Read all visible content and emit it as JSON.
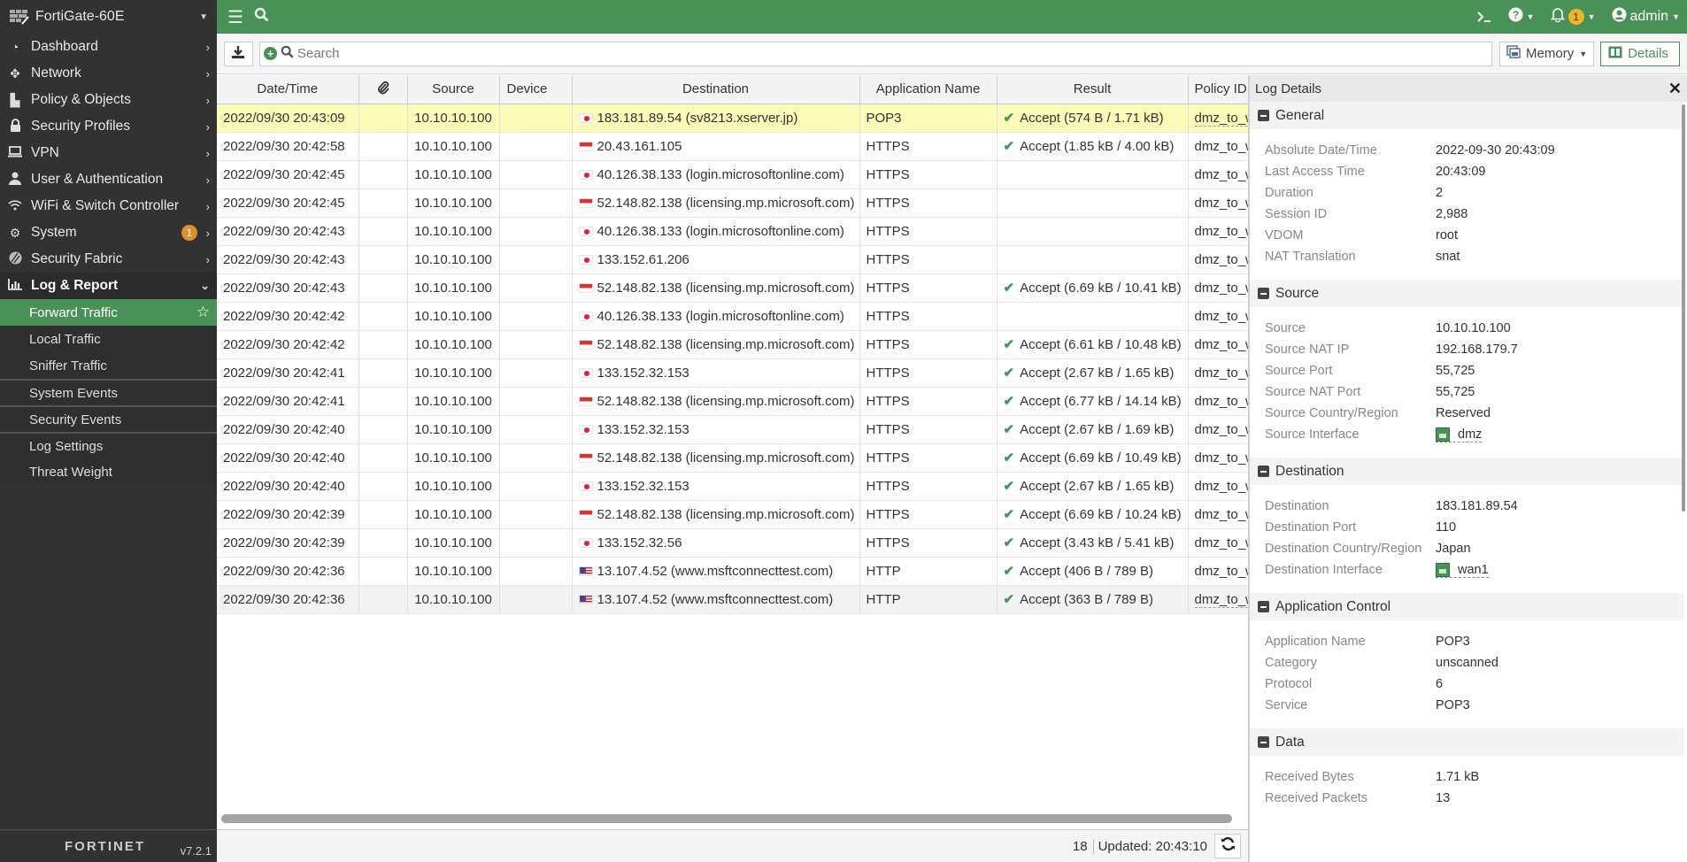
{
  "sidebar": {
    "device_name": "FortiGate-60E",
    "items": [
      {
        "label": "Dashboard",
        "icon": "dashboard-icon"
      },
      {
        "label": "Network",
        "icon": "network-icon"
      },
      {
        "label": "Policy & Objects",
        "icon": "policy-icon"
      },
      {
        "label": "Security Profiles",
        "icon": "lock-icon"
      },
      {
        "label": "VPN",
        "icon": "laptop-icon"
      },
      {
        "label": "User & Authentication",
        "icon": "user-icon"
      },
      {
        "label": "WiFi & Switch Controller",
        "icon": "wifi-icon"
      },
      {
        "label": "System",
        "icon": "gear-icon",
        "badge": "1"
      },
      {
        "label": "Security Fabric",
        "icon": "fabric-icon"
      },
      {
        "label": "Log & Report",
        "icon": "bar-chart-icon"
      }
    ],
    "log_report_sub": [
      {
        "label": "Forward Traffic",
        "active": true
      },
      {
        "label": "Local Traffic"
      },
      {
        "label": "Sniffer Traffic"
      },
      {
        "label": "System Events"
      },
      {
        "label": "Security Events"
      },
      {
        "label": "Log Settings"
      },
      {
        "label": "Threat Weight"
      }
    ],
    "footer_brand": "FORTINET",
    "version": "v7.2.1"
  },
  "topbar": {
    "notification_count": "1",
    "user": "admin"
  },
  "toolbar": {
    "search_placeholder": "Search",
    "memory_label": "Memory",
    "details_label": "Details"
  },
  "table": {
    "columns": [
      "Date/Time",
      "",
      "Source",
      "Device",
      "Destination",
      "Application Name",
      "Result",
      "Policy ID"
    ],
    "rows": [
      {
        "datetime": "2022/09/30 20:43:09",
        "source": "10.10.10.100",
        "device": "",
        "flag": "jp",
        "destination": "183.181.89.54 (sv8213.xserver.jp)",
        "app": "POP3",
        "result": "Accept (574 B / 1.71 kB)",
        "policy": "dmz_to_wan",
        "selected": true
      },
      {
        "datetime": "2022/09/30 20:42:58",
        "source": "10.10.10.100",
        "device": "",
        "flag": "sg",
        "destination": "20.43.161.105",
        "app": "HTTPS",
        "result": "Accept (1.85 kB / 4.00 kB)",
        "policy": "dmz_to_wan"
      },
      {
        "datetime": "2022/09/30 20:42:45",
        "source": "10.10.10.100",
        "device": "",
        "flag": "jp",
        "destination": "40.126.38.133 (login.microsoftonline.com)",
        "app": "HTTPS",
        "result": "",
        "policy": "dmz_to_wan"
      },
      {
        "datetime": "2022/09/30 20:42:45",
        "source": "10.10.10.100",
        "device": "",
        "flag": "sg",
        "destination": "52.148.82.138 (licensing.mp.microsoft.com)",
        "app": "HTTPS",
        "result": "",
        "policy": "dmz_to_wan"
      },
      {
        "datetime": "2022/09/30 20:42:43",
        "source": "10.10.10.100",
        "device": "",
        "flag": "jp",
        "destination": "40.126.38.133 (login.microsoftonline.com)",
        "app": "HTTPS",
        "result": "",
        "policy": "dmz_to_wan"
      },
      {
        "datetime": "2022/09/30 20:42:43",
        "source": "10.10.10.100",
        "device": "",
        "flag": "jp",
        "destination": "133.152.61.206",
        "app": "HTTPS",
        "result": "",
        "policy": "dmz_to_wan"
      },
      {
        "datetime": "2022/09/30 20:42:43",
        "source": "10.10.10.100",
        "device": "",
        "flag": "sg",
        "destination": "52.148.82.138 (licensing.mp.microsoft.com)",
        "app": "HTTPS",
        "result": "Accept (6.69 kB / 10.41 kB)",
        "policy": "dmz_to_wan"
      },
      {
        "datetime": "2022/09/30 20:42:42",
        "source": "10.10.10.100",
        "device": "",
        "flag": "jp",
        "destination": "40.126.38.133 (login.microsoftonline.com)",
        "app": "HTTPS",
        "result": "",
        "policy": "dmz_to_wan"
      },
      {
        "datetime": "2022/09/30 20:42:42",
        "source": "10.10.10.100",
        "device": "",
        "flag": "sg",
        "destination": "52.148.82.138 (licensing.mp.microsoft.com)",
        "app": "HTTPS",
        "result": "Accept (6.61 kB / 10.48 kB)",
        "policy": "dmz_to_wan"
      },
      {
        "datetime": "2022/09/30 20:42:41",
        "source": "10.10.10.100",
        "device": "",
        "flag": "jp",
        "destination": "133.152.32.153",
        "app": "HTTPS",
        "result": "Accept (2.67 kB / 1.65 kB)",
        "policy": "dmz_to_wan"
      },
      {
        "datetime": "2022/09/30 20:42:41",
        "source": "10.10.10.100",
        "device": "",
        "flag": "sg",
        "destination": "52.148.82.138 (licensing.mp.microsoft.com)",
        "app": "HTTPS",
        "result": "Accept (6.77 kB / 14.14 kB)",
        "policy": "dmz_to_wan"
      },
      {
        "datetime": "2022/09/30 20:42:40",
        "source": "10.10.10.100",
        "device": "",
        "flag": "jp",
        "destination": "133.152.32.153",
        "app": "HTTPS",
        "result": "Accept (2.67 kB / 1.69 kB)",
        "policy": "dmz_to_wan"
      },
      {
        "datetime": "2022/09/30 20:42:40",
        "source": "10.10.10.100",
        "device": "",
        "flag": "sg",
        "destination": "52.148.82.138 (licensing.mp.microsoft.com)",
        "app": "HTTPS",
        "result": "Accept (6.69 kB / 10.49 kB)",
        "policy": "dmz_to_wan"
      },
      {
        "datetime": "2022/09/30 20:42:40",
        "source": "10.10.10.100",
        "device": "",
        "flag": "jp",
        "destination": "133.152.32.153",
        "app": "HTTPS",
        "result": "Accept (2.67 kB / 1.65 kB)",
        "policy": "dmz_to_wan"
      },
      {
        "datetime": "2022/09/30 20:42:39",
        "source": "10.10.10.100",
        "device": "",
        "flag": "sg",
        "destination": "52.148.82.138 (licensing.mp.microsoft.com)",
        "app": "HTTPS",
        "result": "Accept (6.69 kB / 10.24 kB)",
        "policy": "dmz_to_wan"
      },
      {
        "datetime": "2022/09/30 20:42:39",
        "source": "10.10.10.100",
        "device": "",
        "flag": "jp",
        "destination": "133.152.32.56",
        "app": "HTTPS",
        "result": "Accept (3.43 kB / 5.41 kB)",
        "policy": "dmz_to_wan"
      },
      {
        "datetime": "2022/09/30 20:42:36",
        "source": "10.10.10.100",
        "device": "",
        "flag": "us",
        "destination": "13.107.4.52 (www.msftconnecttest.com)",
        "app": "HTTP",
        "result": "Accept (406 B / 789 B)",
        "policy": "dmz_to_wan"
      },
      {
        "datetime": "2022/09/30 20:42:36",
        "source": "10.10.10.100",
        "device": "",
        "flag": "us",
        "destination": "13.107.4.52 (www.msftconnecttest.com)",
        "app": "HTTP",
        "result": "Accept (363 B / 789 B)",
        "policy": "dmz_to_wan",
        "hover": true
      }
    ]
  },
  "status": {
    "count": "18",
    "updated": "Updated: 20:43:10"
  },
  "details": {
    "title": "Log Details",
    "sections": [
      {
        "title": "General",
        "fields": [
          {
            "k": "Absolute Date/Time",
            "v": "2022-09-30 20:43:09"
          },
          {
            "k": "Last Access Time",
            "v": "20:43:09"
          },
          {
            "k": "Duration",
            "v": "2"
          },
          {
            "k": "Session ID",
            "v": "2,988"
          },
          {
            "k": "VDOM",
            "v": "root"
          },
          {
            "k": "NAT Translation",
            "v": "snat"
          }
        ]
      },
      {
        "title": "Source",
        "fields": [
          {
            "k": "Source",
            "v": "10.10.10.100"
          },
          {
            "k": "Source NAT IP",
            "v": "192.168.179.7"
          },
          {
            "k": "Source Port",
            "v": "55,725"
          },
          {
            "k": "Source NAT Port",
            "v": "55,725"
          },
          {
            "k": "Source Country/Region",
            "v": "Reserved"
          },
          {
            "k": "Source Interface",
            "v": "dmz",
            "iface": true
          }
        ]
      },
      {
        "title": "Destination",
        "fields": [
          {
            "k": "Destination",
            "v": "183.181.89.54"
          },
          {
            "k": "Destination Port",
            "v": "110"
          },
          {
            "k": "Destination Country/Region",
            "v": "Japan"
          },
          {
            "k": "Destination Interface",
            "v": "wan1",
            "iface": true
          }
        ]
      },
      {
        "title": "Application Control",
        "fields": [
          {
            "k": "Application Name",
            "v": "POP3"
          },
          {
            "k": "Category",
            "v": "unscanned"
          },
          {
            "k": "Protocol",
            "v": "6"
          },
          {
            "k": "Service",
            "v": "POP3"
          }
        ]
      },
      {
        "title": "Data",
        "fields": [
          {
            "k": "Received Bytes",
            "v": "1.71 kB"
          },
          {
            "k": "Received Packets",
            "v": "13"
          }
        ]
      }
    ]
  },
  "colors": {
    "brand_green": "#4a9157",
    "sidebar_bg": "#323232",
    "selected_row": "#fcfcb8",
    "badge_orange": "#e08e2a",
    "notif_yellow": "#f0b429"
  }
}
